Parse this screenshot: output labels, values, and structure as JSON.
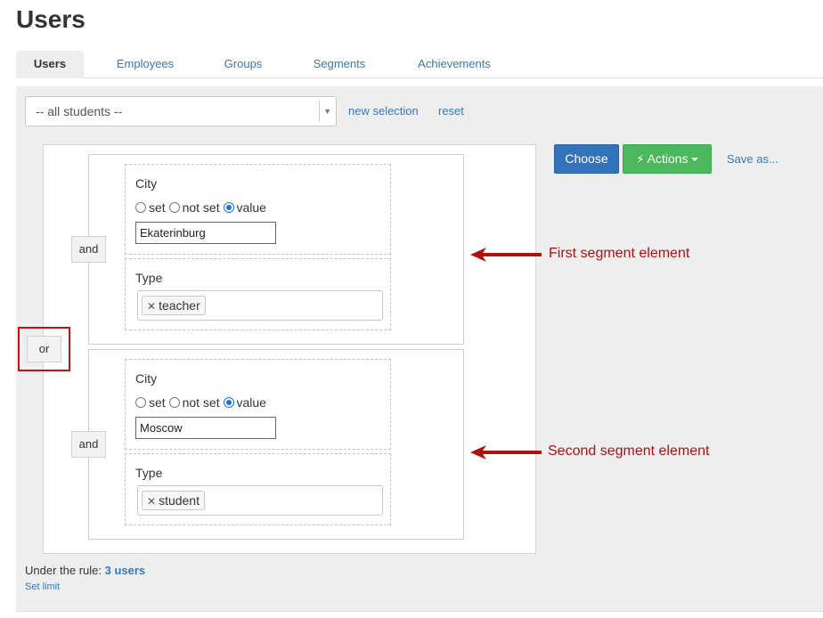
{
  "page_title": "Users",
  "tabs": [
    {
      "label": "Users",
      "active": true
    },
    {
      "label": "Employees"
    },
    {
      "label": "Groups"
    },
    {
      "label": "Segments"
    },
    {
      "label": "Achievements"
    }
  ],
  "filter": {
    "selected": "-- all students --",
    "new_selection": "new selection",
    "reset": "reset"
  },
  "toolbar": {
    "choose": "Choose",
    "actions": "Actions",
    "save_as": "Save as..."
  },
  "operators": {
    "and": "and",
    "or": "or"
  },
  "segments": [
    {
      "city": {
        "label": "City",
        "options": [
          "set",
          "not set",
          "value"
        ],
        "selected": "value",
        "value": "Ekaterinburg"
      },
      "type": {
        "label": "Type",
        "tag": "teacher"
      }
    },
    {
      "city": {
        "label": "City",
        "options": [
          "set",
          "not set",
          "value"
        ],
        "selected": "value",
        "value": "Moscow"
      },
      "type": {
        "label": "Type",
        "tag": "student"
      }
    }
  ],
  "annotations": {
    "first": "First segment element",
    "second": "Second segment element"
  },
  "footer": {
    "under_rule_label": "Under the rule:",
    "users_count": "3 users",
    "set_limit": "Set limit"
  },
  "colors": {
    "accent": "#3a78b4",
    "choose": "#3273ba",
    "actions": "#4cb85d",
    "annotation": "#b01010"
  }
}
